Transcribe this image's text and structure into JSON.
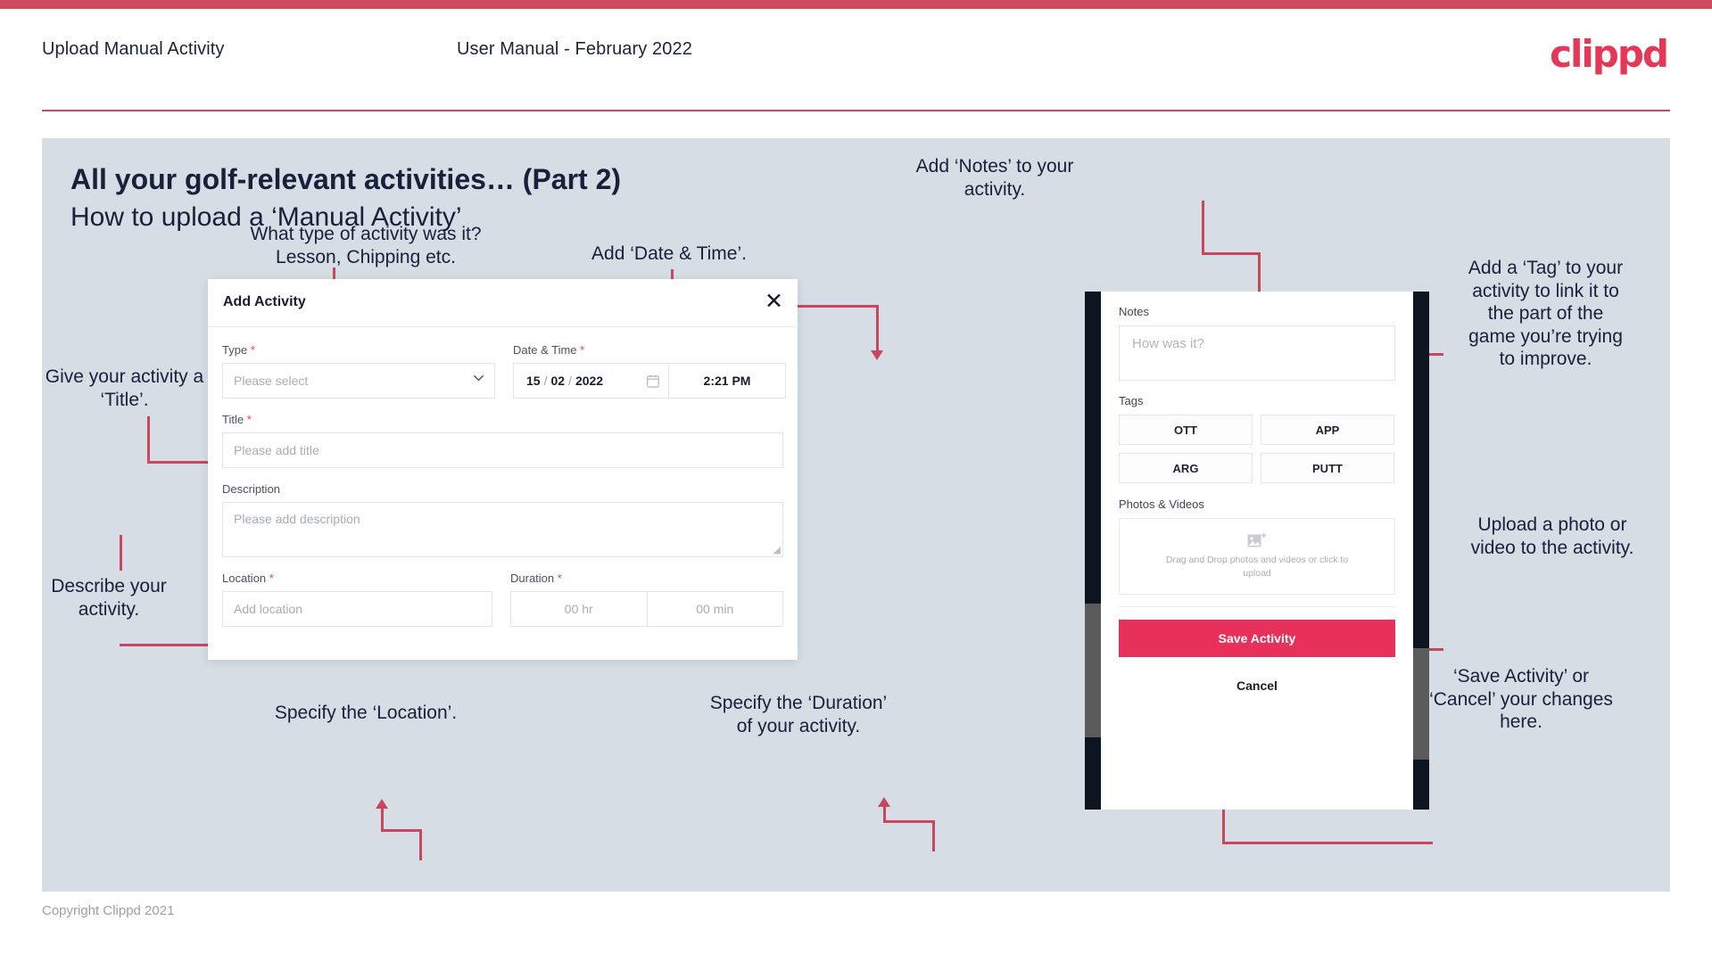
{
  "header": {
    "title": "Upload Manual Activity",
    "subtitle": "User Manual - February 2022",
    "logo": "clippd"
  },
  "slide": {
    "title": "All your golf-relevant activities… (Part 2)",
    "subtitle": "How to upload a ‘Manual Activity’"
  },
  "annotations": {
    "type": "What type of activity was it?\nLesson, Chipping etc.",
    "datetime": "Add ‘Date & Time’.",
    "title": "Give your activity a\n‘Title’.",
    "description": "Describe your\nactivity.",
    "location": "Specify the ‘Location’.",
    "duration": "Specify the ‘Duration’\nof your activity.",
    "notes": "Add ‘Notes’ to your\nactivity.",
    "tags": "Add a ‘Tag’ to your\nactivity to link it to\nthe part of the\ngame you’re trying\nto improve.",
    "photos": "Upload a photo or\nvideo to the activity.",
    "save": "‘Save Activity’ or\n‘Cancel’ your changes\nhere."
  },
  "modal": {
    "title": "Add Activity",
    "close_label": "✕",
    "fields": {
      "type_label": "Type",
      "type_placeholder": "Please select",
      "datetime_label": "Date & Time",
      "date_day": "15",
      "date_month": "02",
      "date_year": "2022",
      "date_sep": "/",
      "time_value": "2:21 PM",
      "title_label": "Title",
      "title_placeholder": "Please add title",
      "description_label": "Description",
      "description_placeholder": "Please add description",
      "location_label": "Location",
      "location_placeholder": "Add location",
      "duration_label": "Duration",
      "duration_hr": "00 hr",
      "duration_min": "00 min"
    },
    "required_mark": "*"
  },
  "phone": {
    "notes_label": "Notes",
    "notes_placeholder": "How was it?",
    "tags_label": "Tags",
    "tags": [
      "OTT",
      "APP",
      "ARG",
      "PUTT"
    ],
    "photos_label": "Photos & Videos",
    "drop_text": "Drag and Drop photos and videos or click to upload",
    "save_label": "Save Activity",
    "cancel_label": "Cancel"
  },
  "footer": {
    "copyright": "Copyright Clippd 2021"
  },
  "colors": {
    "brand_red": "#e8315a",
    "accent_line": "#c8475e",
    "top_bar": "#d04a5d",
    "slide_bg": "#d7dde5",
    "text_dark": "#17213a"
  }
}
